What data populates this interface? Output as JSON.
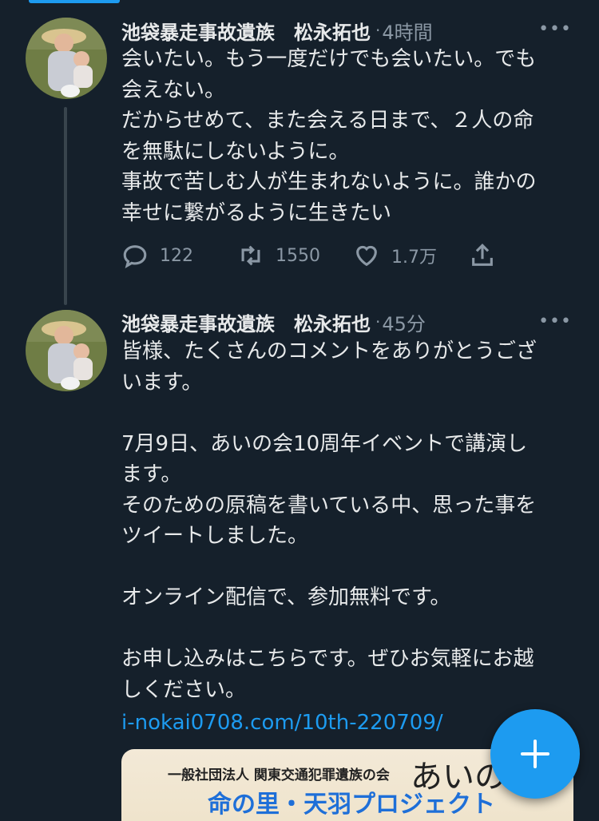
{
  "colors": {
    "background": "#15202b",
    "accent": "#1d9bf0",
    "muted": "#8b98a5",
    "text": "#e7e9ea"
  },
  "tweets": [
    {
      "author": "池袋暴走事故遺族　松永拓也",
      "separator": "·",
      "time": "4時間",
      "more_icon": "more-horizontal-icon",
      "text": "会いたい。もう一度だけでも会いたい。でも\n会えない。\nだからせめて、また会える日まで、２人の命\nを無駄にしないように。\n事故で苦しむ人が生まれないように。誰かの\n幸せに繋がるように生きたい",
      "replies": "122",
      "retweets": "1550",
      "likes": "1.7万"
    },
    {
      "author": "池袋暴走事故遺族　松永拓也",
      "separator": "·",
      "time": "45分",
      "more_icon": "more-horizontal-icon",
      "text": "皆様、たくさんのコメントをありがとうござ\nいます。\n\n7月9日、あいの会10周年イベントで講演し\nます。\nそのための原稿を書いている中、思った事を\nツイートしました。\n\nオンライン配信で、参加無料です。\n\nお申し込みはこちらです。ぜひお気軽にお越\nしください。",
      "link": "i-nokai0708.com/10th-220709/",
      "card": {
        "line1": "一般社団法人 関東交通犯罪遺族の会",
        "logo": "あいの",
        "line2": "命の里・天羽プロジェクト"
      }
    }
  ],
  "fab": {
    "icon": "plus-icon"
  }
}
